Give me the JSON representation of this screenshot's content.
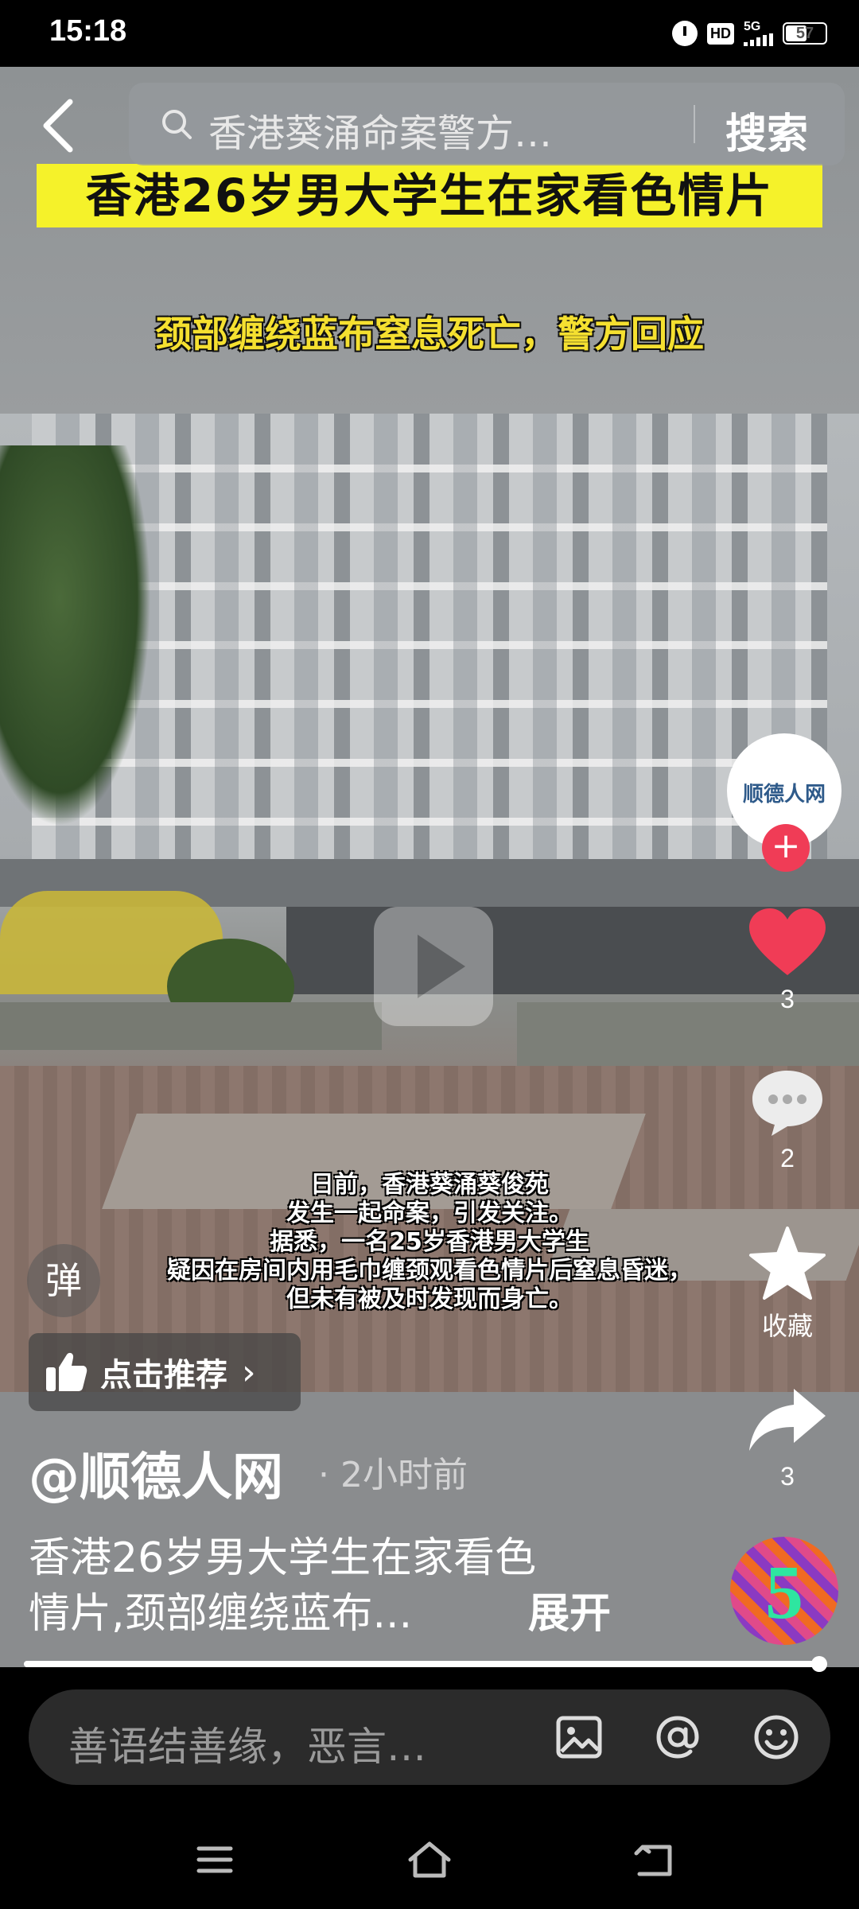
{
  "status_bar": {
    "time": "15:18",
    "network": "5G",
    "hd": "HD",
    "battery": "57",
    "battery_level": 0.57
  },
  "search": {
    "query": "香港葵涌命案警方…",
    "button": "搜索"
  },
  "video": {
    "title_banner": "香港26岁男大学生在家看色情片",
    "subtitle_banner": "颈部缠绕蓝布窒息死亡，警方回应",
    "caption_lines": [
      "日前，香港葵涌葵俊苑",
      "发生一起命案，引发关注。",
      "据悉，一名25岁香港男大学生",
      "疑因在房间内用毛巾缠颈观看色情片后窒息昏迷，",
      "但未有被及时发现而身亡。"
    ],
    "progress": 0.99
  },
  "side_rail": {
    "avatar_text": "顺德人网",
    "follow": "+",
    "likes": "3",
    "comments": "2",
    "favorite_label": "收藏",
    "shares": "3",
    "music_glyph": "5",
    "colors": {
      "like": "#f03c56",
      "follow": "#f03c56"
    }
  },
  "overlay": {
    "danmu_toggle": "弹",
    "recommend_label": "点击推荐"
  },
  "post": {
    "author": "@顺德人网",
    "time_ago": "· 2小时前",
    "desc_line1": "香港26岁男大学生在家看色",
    "desc_line2": "情片,颈部缠绕蓝布...",
    "expand": "展开"
  },
  "comment_bar": {
    "placeholder": "善语结善缘，恶言…",
    "icons": [
      "image-icon",
      "at-icon",
      "emoji-icon"
    ]
  },
  "nav_bar": {
    "icons": [
      "menu-icon",
      "home-icon",
      "back-icon"
    ]
  }
}
